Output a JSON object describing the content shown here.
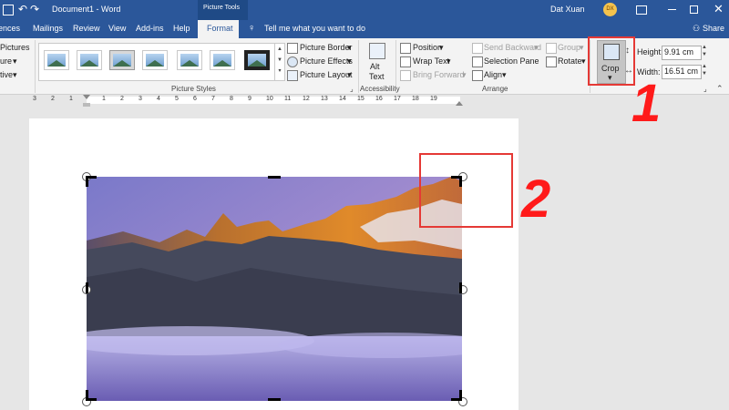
{
  "titlebar": {
    "document_title": "Document1 - Word",
    "context_group": "Picture Tools",
    "user_name": "Dat Xuan",
    "user_initials": "DX"
  },
  "tabs": [
    "ences",
    "Mailings",
    "Review",
    "View",
    "Add-ins",
    "Help",
    "Format"
  ],
  "tell_me": "Tell me what you want to do",
  "share": "Share",
  "ribbon": {
    "left_items": [
      "Pictures",
      "ure",
      "tive"
    ],
    "picture_styles_label": "Picture Styles",
    "picture_border": "Picture Border",
    "picture_effects": "Picture Effects",
    "picture_layout": "Picture Layout",
    "alt_text": [
      "Alt",
      "Text"
    ],
    "accessibility_label": "Accessibility",
    "position": "Position",
    "wrap_text": "Wrap Text",
    "bring_forward": "Bring Forward",
    "send_backward": "Send Backward",
    "selection_pane": "Selection Pane",
    "align": "Align",
    "group": "Group",
    "rotate": "Rotate",
    "arrange_label": "Arrange",
    "crop": "Crop",
    "height_label": "Height:",
    "height_value": "9.91 cm",
    "width_label": "Width:",
    "width_value": "16.51 cm"
  },
  "ruler": {
    "numbers": [
      "3",
      "2",
      "1",
      "1",
      "2",
      "3",
      "4",
      "5",
      "6",
      "7",
      "8",
      "9",
      "10",
      "11",
      "12",
      "13",
      "14",
      "15",
      "16",
      "17",
      "18",
      "19"
    ]
  },
  "annotations": {
    "step1": "1",
    "step2": "2"
  },
  "colors": {
    "word_blue": "#2b579a",
    "ribbon_bg": "#f3f3f3",
    "highlight_red": "#e53935",
    "annotation_red": "#ff1a1a"
  }
}
